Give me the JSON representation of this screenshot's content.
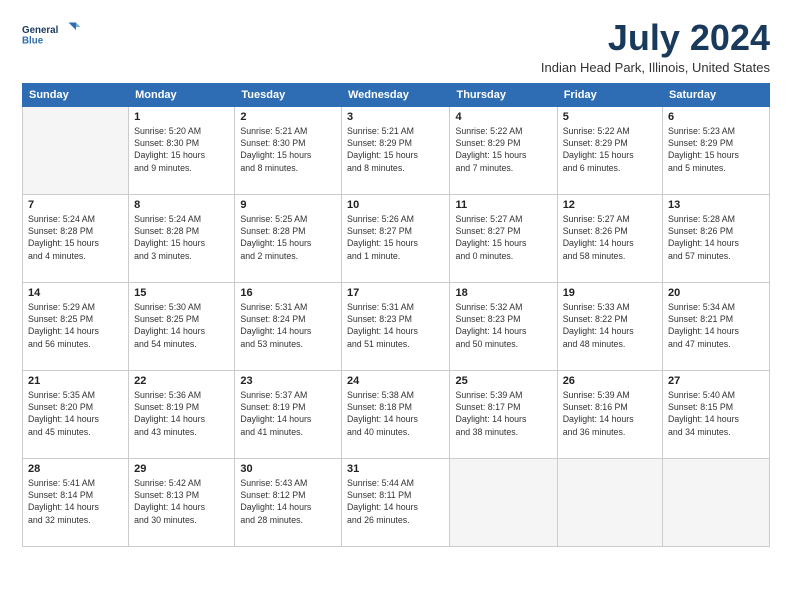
{
  "header": {
    "logo_line1": "General",
    "logo_line2": "Blue",
    "month_title": "July 2024",
    "location": "Indian Head Park, Illinois, United States"
  },
  "weekdays": [
    "Sunday",
    "Monday",
    "Tuesday",
    "Wednesday",
    "Thursday",
    "Friday",
    "Saturday"
  ],
  "weeks": [
    [
      {
        "day": "",
        "info": ""
      },
      {
        "day": "1",
        "info": "Sunrise: 5:20 AM\nSunset: 8:30 PM\nDaylight: 15 hours\nand 9 minutes."
      },
      {
        "day": "2",
        "info": "Sunrise: 5:21 AM\nSunset: 8:30 PM\nDaylight: 15 hours\nand 8 minutes."
      },
      {
        "day": "3",
        "info": "Sunrise: 5:21 AM\nSunset: 8:29 PM\nDaylight: 15 hours\nand 8 minutes."
      },
      {
        "day": "4",
        "info": "Sunrise: 5:22 AM\nSunset: 8:29 PM\nDaylight: 15 hours\nand 7 minutes."
      },
      {
        "day": "5",
        "info": "Sunrise: 5:22 AM\nSunset: 8:29 PM\nDaylight: 15 hours\nand 6 minutes."
      },
      {
        "day": "6",
        "info": "Sunrise: 5:23 AM\nSunset: 8:29 PM\nDaylight: 15 hours\nand 5 minutes."
      }
    ],
    [
      {
        "day": "7",
        "info": "Sunrise: 5:24 AM\nSunset: 8:28 PM\nDaylight: 15 hours\nand 4 minutes."
      },
      {
        "day": "8",
        "info": "Sunrise: 5:24 AM\nSunset: 8:28 PM\nDaylight: 15 hours\nand 3 minutes."
      },
      {
        "day": "9",
        "info": "Sunrise: 5:25 AM\nSunset: 8:28 PM\nDaylight: 15 hours\nand 2 minutes."
      },
      {
        "day": "10",
        "info": "Sunrise: 5:26 AM\nSunset: 8:27 PM\nDaylight: 15 hours\nand 1 minute."
      },
      {
        "day": "11",
        "info": "Sunrise: 5:27 AM\nSunset: 8:27 PM\nDaylight: 15 hours\nand 0 minutes."
      },
      {
        "day": "12",
        "info": "Sunrise: 5:27 AM\nSunset: 8:26 PM\nDaylight: 14 hours\nand 58 minutes."
      },
      {
        "day": "13",
        "info": "Sunrise: 5:28 AM\nSunset: 8:26 PM\nDaylight: 14 hours\nand 57 minutes."
      }
    ],
    [
      {
        "day": "14",
        "info": "Sunrise: 5:29 AM\nSunset: 8:25 PM\nDaylight: 14 hours\nand 56 minutes."
      },
      {
        "day": "15",
        "info": "Sunrise: 5:30 AM\nSunset: 8:25 PM\nDaylight: 14 hours\nand 54 minutes."
      },
      {
        "day": "16",
        "info": "Sunrise: 5:31 AM\nSunset: 8:24 PM\nDaylight: 14 hours\nand 53 minutes."
      },
      {
        "day": "17",
        "info": "Sunrise: 5:31 AM\nSunset: 8:23 PM\nDaylight: 14 hours\nand 51 minutes."
      },
      {
        "day": "18",
        "info": "Sunrise: 5:32 AM\nSunset: 8:23 PM\nDaylight: 14 hours\nand 50 minutes."
      },
      {
        "day": "19",
        "info": "Sunrise: 5:33 AM\nSunset: 8:22 PM\nDaylight: 14 hours\nand 48 minutes."
      },
      {
        "day": "20",
        "info": "Sunrise: 5:34 AM\nSunset: 8:21 PM\nDaylight: 14 hours\nand 47 minutes."
      }
    ],
    [
      {
        "day": "21",
        "info": "Sunrise: 5:35 AM\nSunset: 8:20 PM\nDaylight: 14 hours\nand 45 minutes."
      },
      {
        "day": "22",
        "info": "Sunrise: 5:36 AM\nSunset: 8:19 PM\nDaylight: 14 hours\nand 43 minutes."
      },
      {
        "day": "23",
        "info": "Sunrise: 5:37 AM\nSunset: 8:19 PM\nDaylight: 14 hours\nand 41 minutes."
      },
      {
        "day": "24",
        "info": "Sunrise: 5:38 AM\nSunset: 8:18 PM\nDaylight: 14 hours\nand 40 minutes."
      },
      {
        "day": "25",
        "info": "Sunrise: 5:39 AM\nSunset: 8:17 PM\nDaylight: 14 hours\nand 38 minutes."
      },
      {
        "day": "26",
        "info": "Sunrise: 5:39 AM\nSunset: 8:16 PM\nDaylight: 14 hours\nand 36 minutes."
      },
      {
        "day": "27",
        "info": "Sunrise: 5:40 AM\nSunset: 8:15 PM\nDaylight: 14 hours\nand 34 minutes."
      }
    ],
    [
      {
        "day": "28",
        "info": "Sunrise: 5:41 AM\nSunset: 8:14 PM\nDaylight: 14 hours\nand 32 minutes."
      },
      {
        "day": "29",
        "info": "Sunrise: 5:42 AM\nSunset: 8:13 PM\nDaylight: 14 hours\nand 30 minutes."
      },
      {
        "day": "30",
        "info": "Sunrise: 5:43 AM\nSunset: 8:12 PM\nDaylight: 14 hours\nand 28 minutes."
      },
      {
        "day": "31",
        "info": "Sunrise: 5:44 AM\nSunset: 8:11 PM\nDaylight: 14 hours\nand 26 minutes."
      },
      {
        "day": "",
        "info": ""
      },
      {
        "day": "",
        "info": ""
      },
      {
        "day": "",
        "info": ""
      }
    ]
  ]
}
